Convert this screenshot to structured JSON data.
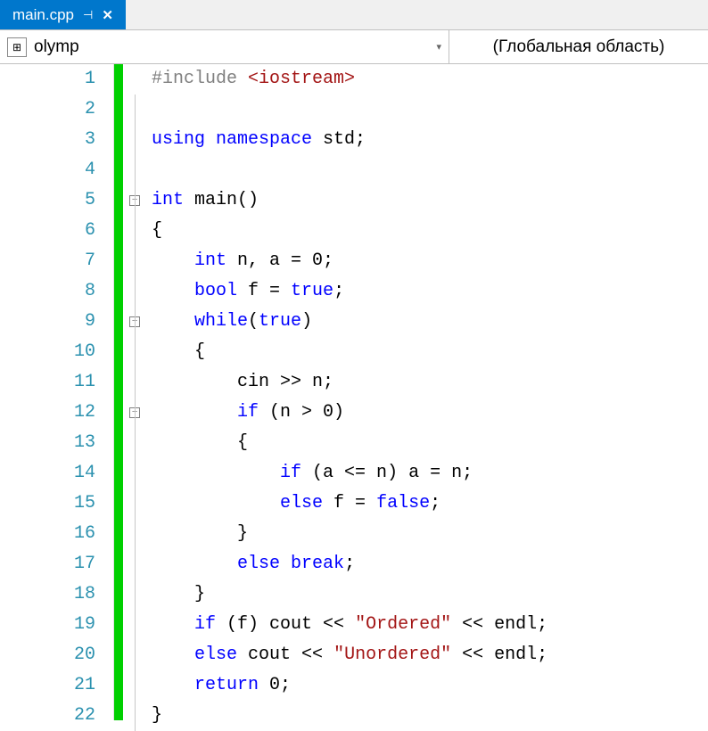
{
  "tab": {
    "filename": "main.cpp",
    "pin_glyph": "⊣",
    "close_glyph": "✕"
  },
  "scope": {
    "left_icon": "⊞",
    "name": "olymp",
    "dropdown": "▾",
    "right": "(Глобальная область)"
  },
  "lines": [
    {
      "n": "1",
      "fold": "",
      "tokens": [
        [
          "pp",
          "#include "
        ],
        [
          "str",
          "<iostream>"
        ]
      ]
    },
    {
      "n": "2",
      "fold": "|",
      "tokens": []
    },
    {
      "n": "3",
      "fold": "|",
      "tokens": [
        [
          "kw",
          "using "
        ],
        [
          "kw",
          "namespace"
        ],
        [
          "txt",
          " std;"
        ]
      ]
    },
    {
      "n": "4",
      "fold": "|",
      "tokens": []
    },
    {
      "n": "5",
      "fold": "box",
      "tokens": [
        [
          "kw",
          "int"
        ],
        [
          "txt",
          " main()"
        ]
      ]
    },
    {
      "n": "6",
      "fold": "|",
      "tokens": [
        [
          "txt",
          "{"
        ]
      ]
    },
    {
      "n": "7",
      "fold": "|",
      "tokens": [
        [
          "txt",
          "    "
        ],
        [
          "kw",
          "int"
        ],
        [
          "txt",
          " n, a = 0;"
        ]
      ]
    },
    {
      "n": "8",
      "fold": "|",
      "tokens": [
        [
          "txt",
          "    "
        ],
        [
          "kw",
          "bool"
        ],
        [
          "txt",
          " f = "
        ],
        [
          "kw",
          "true"
        ],
        [
          "txt",
          ";"
        ]
      ]
    },
    {
      "n": "9",
      "fold": "box",
      "tokens": [
        [
          "txt",
          "    "
        ],
        [
          "kw",
          "while"
        ],
        [
          "txt",
          "("
        ],
        [
          "kw",
          "true"
        ],
        [
          "txt",
          ")"
        ]
      ]
    },
    {
      "n": "10",
      "fold": "|",
      "tokens": [
        [
          "txt",
          "    {"
        ]
      ]
    },
    {
      "n": "11",
      "fold": "|",
      "tokens": [
        [
          "txt",
          "        cin >> n;"
        ]
      ]
    },
    {
      "n": "12",
      "fold": "box",
      "tokens": [
        [
          "txt",
          "        "
        ],
        [
          "kw",
          "if"
        ],
        [
          "txt",
          " (n > 0)"
        ]
      ]
    },
    {
      "n": "13",
      "fold": "|",
      "tokens": [
        [
          "txt",
          "        {"
        ]
      ]
    },
    {
      "n": "14",
      "fold": "|",
      "tokens": [
        [
          "txt",
          "            "
        ],
        [
          "kw",
          "if"
        ],
        [
          "txt",
          " (a <= n) a = n;"
        ]
      ]
    },
    {
      "n": "15",
      "fold": "|",
      "tokens": [
        [
          "txt",
          "            "
        ],
        [
          "kw",
          "else"
        ],
        [
          "txt",
          " f = "
        ],
        [
          "kw",
          "false"
        ],
        [
          "txt",
          ";"
        ]
      ]
    },
    {
      "n": "16",
      "fold": "|",
      "tokens": [
        [
          "txt",
          "        }"
        ]
      ]
    },
    {
      "n": "17",
      "fold": "|",
      "tokens": [
        [
          "txt",
          "        "
        ],
        [
          "kw",
          "else"
        ],
        [
          "txt",
          " "
        ],
        [
          "kw",
          "break"
        ],
        [
          "txt",
          ";"
        ]
      ]
    },
    {
      "n": "18",
      "fold": "|",
      "tokens": [
        [
          "txt",
          "    }"
        ]
      ]
    },
    {
      "n": "19",
      "fold": "|",
      "tokens": [
        [
          "txt",
          "    "
        ],
        [
          "kw",
          "if"
        ],
        [
          "txt",
          " (f) cout << "
        ],
        [
          "str",
          "\"Ordered\""
        ],
        [
          "txt",
          " << endl;"
        ]
      ]
    },
    {
      "n": "20",
      "fold": "|",
      "tokens": [
        [
          "txt",
          "    "
        ],
        [
          "kw",
          "else"
        ],
        [
          "txt",
          " cout << "
        ],
        [
          "str",
          "\"Unordered\""
        ],
        [
          "txt",
          " << endl;"
        ]
      ]
    },
    {
      "n": "21",
      "fold": "|",
      "tokens": [
        [
          "txt",
          "    "
        ],
        [
          "kw",
          "return"
        ],
        [
          "txt",
          " 0;"
        ]
      ]
    },
    {
      "n": "22",
      "fold": "|",
      "tokens": [
        [
          "txt",
          "}"
        ]
      ]
    }
  ]
}
